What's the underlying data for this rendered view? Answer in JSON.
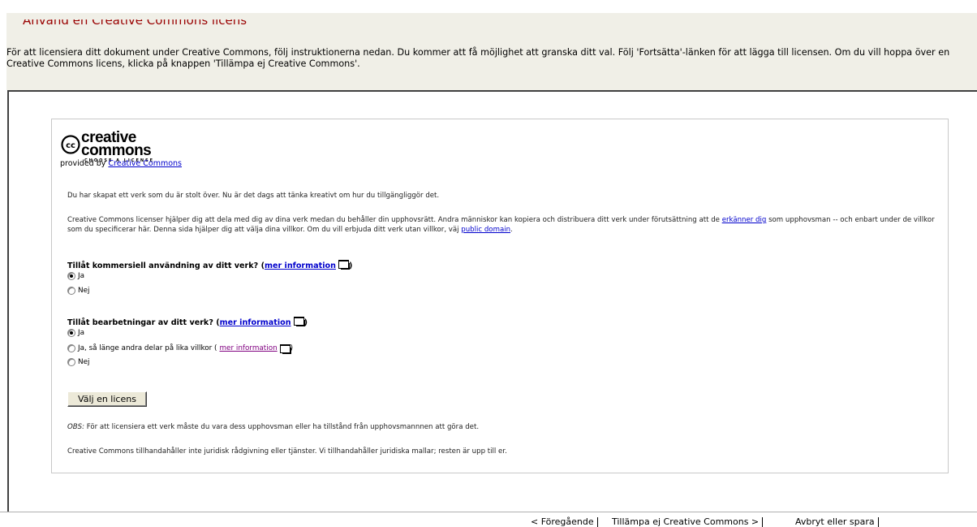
{
  "page": {
    "title": "Använd en Creative Commons licens",
    "intro": "För att licensiera ditt dokument under Creative Commons, följ instruktionerna nedan. Du kommer att få möjlighet att granska ditt val. Följ 'Fortsätta'-länken för att lägga till licensen. Om du vill hoppa över en Creative Commons licens, klicka på knappen 'Tillämpa ej Creative Commons'."
  },
  "logo": {
    "brand_line1": "creative",
    "brand_line2": "commons",
    "tagline": "CHOOSE A LICENSE",
    "cc": "cc",
    "provided_prefix": "provided by ",
    "provided_link": "Creative Commons"
  },
  "content": {
    "p1": "Du har skapat ett verk som du är stolt över. Nu är det dags att tänka kreativt om hur du tillgängliggör det.",
    "p2_a": "Creative Commons licenser hjälper dig att dela med dig av dina verk medan du behåller din upphovsrätt. Andra människor kan kopiera och distribuera ditt verk under förutsättning att de ",
    "p2_link1": "erkänner dig",
    "p2_b": " som upphovsman -- och enbart under de villkor som du specificerar här. Denna sida hjälper dig att välja dina villkor. Om du vill erbjuda ditt verk utan villkor, väj ",
    "p2_link2": "public domain",
    "p2_c": "."
  },
  "q1": {
    "label": "Tillåt kommersiell användning av ditt verk? (",
    "link": "mer information",
    "close": ")",
    "options": [
      {
        "label": "Ja",
        "checked": true
      },
      {
        "label": "Nej",
        "checked": false
      }
    ]
  },
  "q2": {
    "label": "Tillåt bearbetningar av ditt verk? (",
    "link": "mer information",
    "close": ")",
    "options": [
      {
        "label": "Ja",
        "checked": true
      },
      {
        "label": "Ja, så länge andra delar på lika villkor (",
        "link": "mer information",
        "close": ")",
        "checked": false
      },
      {
        "label": "Nej",
        "checked": false
      }
    ]
  },
  "button": {
    "label": "Välj en licens"
  },
  "notes": {
    "obs_label": "OBS:",
    "obs_text": " För att licensiera ett verk måste du vara dess upphovsman eller ha tillstånd från upphovsmannnen att göra det.",
    "disclaimer": "Creative Commons tillhandahåller inte juridisk rådgivning eller tjänster. Vi tillhandahåller juridiska mallar; resten är upp till er."
  },
  "footer": {
    "prev": "< Föregående",
    "skip": "Tillämpa ej Creative Commons >",
    "cancel": "Avbryt eller spara"
  }
}
